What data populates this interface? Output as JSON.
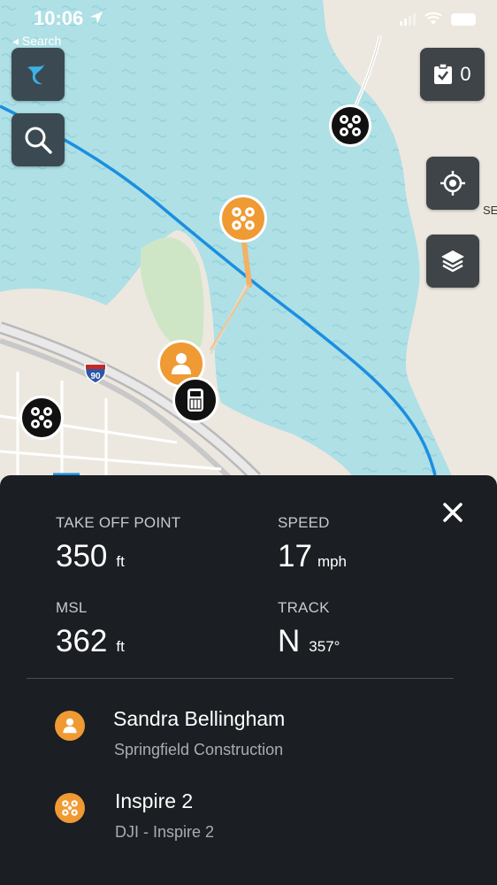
{
  "status_bar": {
    "time": "10:06",
    "back_label": "◂ Search"
  },
  "map": {
    "checklist_count": "0",
    "shield_number": "90",
    "edge_label": "SE"
  },
  "panel": {
    "stats": [
      {
        "label": "TAKE OFF POINT",
        "value": "350",
        "unit": "ft"
      },
      {
        "label": "SPEED",
        "value": "17",
        "unit": "mph"
      },
      {
        "label": "MSL",
        "value": "362",
        "unit": "ft"
      },
      {
        "label": "TRACK",
        "value": "N",
        "unit": "357°"
      }
    ],
    "pilot": {
      "name": "Sandra Bellingham",
      "org": "Springfield Construction"
    },
    "aircraft": {
      "name": "Inspire 2",
      "model": "DJI - Inspire 2"
    }
  },
  "colors": {
    "accent": "#ef9a33",
    "water": "#aee0e6",
    "land": "#ece8df",
    "route": "#1b8fe0",
    "panel": "#1b1e22"
  },
  "icons": [
    "location-arrow-icon",
    "app-logo-icon",
    "search-icon",
    "checklist-icon",
    "locate-icon",
    "layers-icon",
    "drone-icon",
    "person-icon",
    "vehicle-icon",
    "close-icon"
  ]
}
